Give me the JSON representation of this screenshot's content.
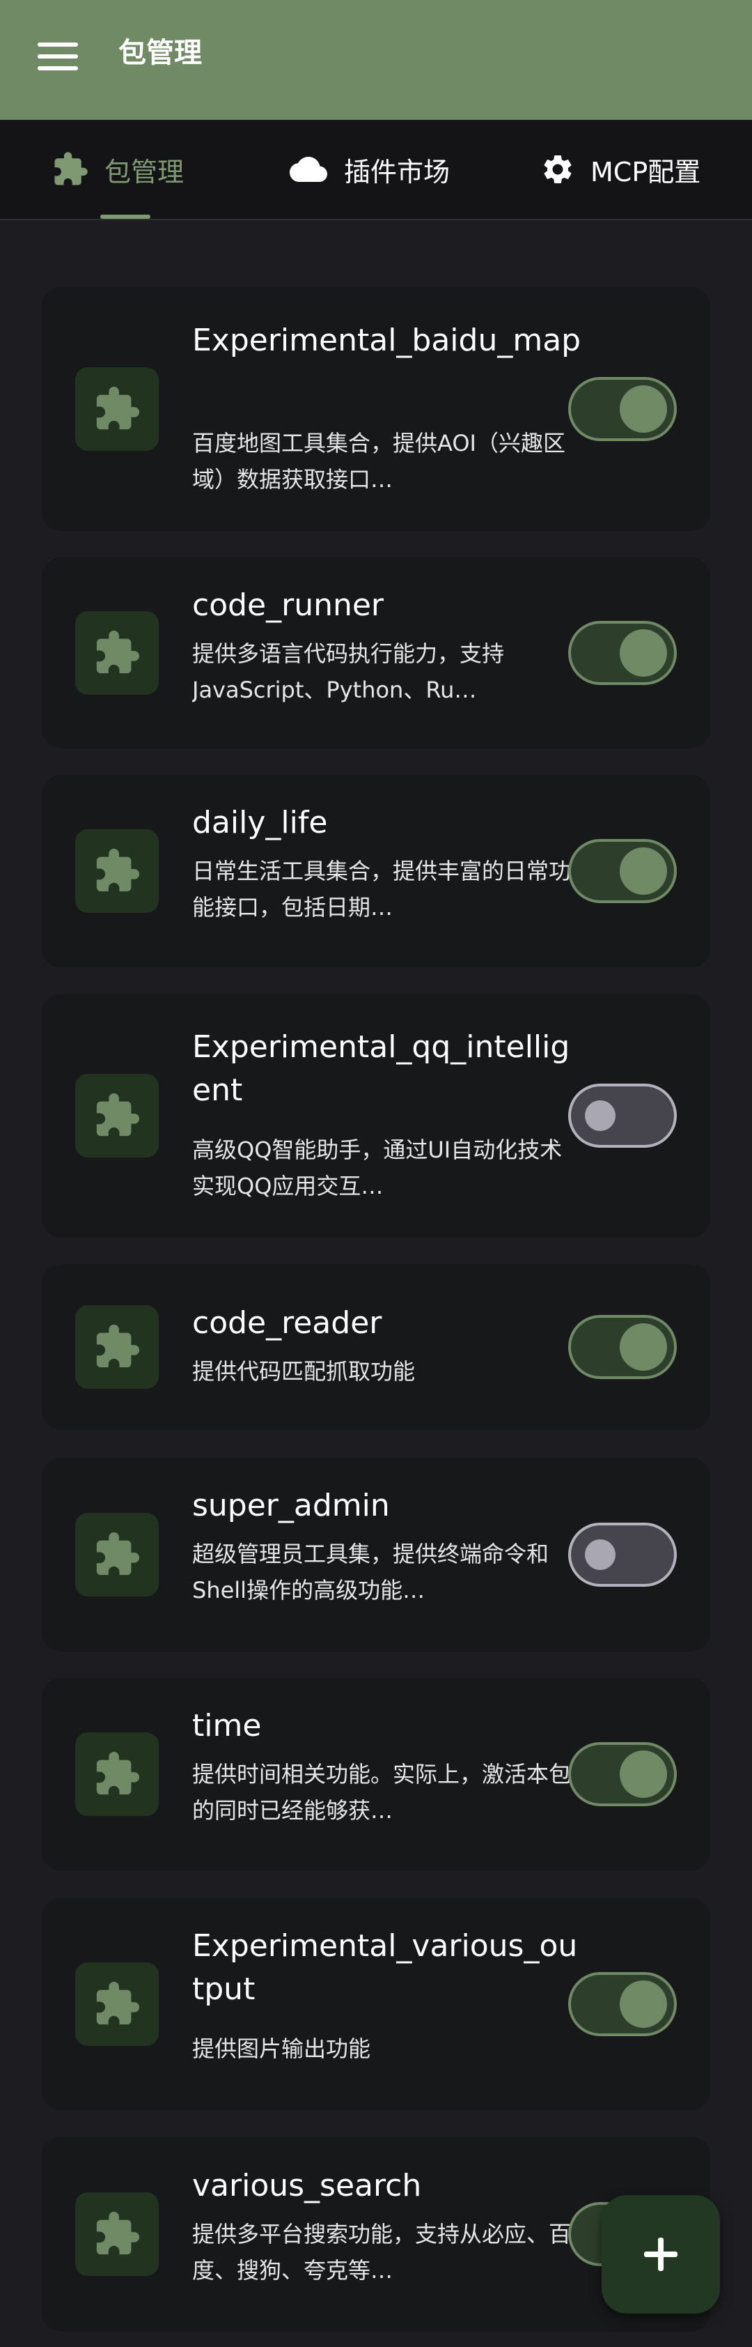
{
  "appbar": {
    "title": "包管理",
    "menu_icon": "menu-icon",
    "color": "#6f8a65"
  },
  "tabs": [
    {
      "label": "包管理",
      "icon": "puzzle-icon",
      "active": true
    },
    {
      "label": "插件市场",
      "icon": "cloud-icon",
      "active": false
    },
    {
      "label": "MCP配置",
      "icon": "gear-icon",
      "active": false
    }
  ],
  "packages": [
    {
      "name": "Experimental_baidu_map",
      "description": "百度地图工具集合，提供AOI（兴趣区域）数据获取接口…",
      "enabled": true
    },
    {
      "name": "code_runner",
      "description": "提供多语言代码执行能力，支持JavaScript、Python、Ru…",
      "enabled": true
    },
    {
      "name": "daily_life",
      "description": "日常生活工具集合，提供丰富的日常功能接口，包括日期…",
      "enabled": true
    },
    {
      "name": "Experimental_qq_intelligent",
      "description": "高级QQ智能助手，通过UI自动化技术实现QQ应用交互…",
      "enabled": false
    },
    {
      "name": "code_reader",
      "description": "提供代码匹配抓取功能",
      "enabled": true
    },
    {
      "name": "super_admin",
      "description": "超级管理员工具集，提供终端命令和Shell操作的高级功能…",
      "enabled": false
    },
    {
      "name": "time",
      "description": "提供时间相关功能。实际上，激活本包的同时已经能够获…",
      "enabled": true
    },
    {
      "name": "Experimental_various_output",
      "description": "提供图片输出功能",
      "enabled": true
    },
    {
      "name": "various_search",
      "description": "提供多平台搜索功能，支持从必应、百度、搜狗、夸克等…",
      "enabled": true
    }
  ],
  "fab": {
    "icon": "plus-icon"
  },
  "colors": {
    "accent": "#7f9a72",
    "toggle_on_track": "#2d3f2a",
    "toggle_off_track": "#46454e",
    "card_bg": "#17181a",
    "background": "#1d1d21"
  }
}
